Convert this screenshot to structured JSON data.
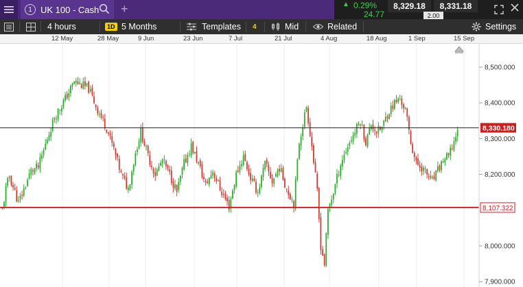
{
  "top_bar": {
    "menu_icon": "hamburger-icon",
    "tab_number": "1",
    "tab_title": "UK 100 - Cash",
    "add_tab_label": "+",
    "change_percent": "0.29%",
    "change_points": "24.77",
    "sell_price": "8,329.18",
    "buy_price": "8,331.18",
    "spread": "2.00",
    "up_color": "#3fcf4f"
  },
  "toolbar": {
    "interval": "4 hours",
    "period_badge": "1D",
    "period": "5 Months",
    "templates": "Templates",
    "indicator_count": "4",
    "price_type": "Mid",
    "related": "Related",
    "settings": "Settings"
  },
  "chart_data": {
    "type": "candlestick",
    "x_ticks": [
      "12 May",
      "28 May",
      "9 Jun",
      "23 Jun",
      "7 Jul",
      "21 Jul",
      "4 Aug",
      "18 Aug",
      "1 Sep",
      "15 Sep"
    ],
    "y_ticks": [
      "8,500.000",
      "8,400.000",
      "8,300.000",
      "8,200.000",
      "8,000.000",
      "7,900.000"
    ],
    "y_tick_values": [
      8500,
      8400,
      8300,
      8200,
      8000,
      7900
    ],
    "ylim": [
      7885,
      8565
    ],
    "current_price": "8,330.180",
    "current_price_value": 8330.18,
    "level_price": "8,107.322",
    "level_price_value": 8107.322,
    "up_color": "#2cad2c",
    "down_color": "#d23b2f",
    "level_color": "#e01b1b",
    "anchors": [
      [
        0,
        8100
      ],
      [
        2,
        8160
      ],
      [
        4,
        8195
      ],
      [
        5,
        8180
      ],
      [
        9,
        8120
      ],
      [
        16,
        8210
      ],
      [
        20,
        8220
      ],
      [
        22,
        8250
      ],
      [
        25,
        8300
      ],
      [
        29,
        8360
      ],
      [
        36,
        8420
      ],
      [
        40,
        8460
      ],
      [
        44,
        8450
      ],
      [
        48,
        8440
      ],
      [
        53,
        8380
      ],
      [
        58,
        8330
      ],
      [
        62,
        8270
      ],
      [
        66,
        8200
      ],
      [
        70,
        8160
      ],
      [
        74,
        8260
      ],
      [
        77,
        8320
      ],
      [
        81,
        8250
      ],
      [
        85,
        8200
      ],
      [
        89,
        8240
      ],
      [
        93,
        8200
      ],
      [
        97,
        8150
      ],
      [
        101,
        8230
      ],
      [
        105,
        8280
      ],
      [
        109,
        8230
      ],
      [
        113,
        8170
      ],
      [
        117,
        8210
      ],
      [
        121,
        8160
      ],
      [
        126,
        8110
      ],
      [
        130,
        8200
      ],
      [
        134,
        8250
      ],
      [
        138,
        8190
      ],
      [
        142,
        8150
      ],
      [
        146,
        8230
      ],
      [
        150,
        8180
      ],
      [
        154,
        8220
      ],
      [
        158,
        8160
      ],
      [
        162,
        8120
      ],
      [
        165,
        8290
      ],
      [
        169,
        8390
      ],
      [
        172,
        8280
      ],
      [
        175,
        8150
      ],
      [
        177,
        8000
      ],
      [
        179,
        7950
      ],
      [
        181,
        8100
      ],
      [
        184,
        8150
      ],
      [
        188,
        8230
      ],
      [
        192,
        8280
      ],
      [
        196,
        8320
      ],
      [
        199,
        8350
      ],
      [
        202,
        8290
      ],
      [
        205,
        8340
      ],
      [
        208,
        8320
      ],
      [
        211,
        8330
      ],
      [
        214,
        8370
      ],
      [
        218,
        8400
      ],
      [
        221,
        8410
      ],
      [
        224,
        8380
      ],
      [
        227,
        8290
      ],
      [
        230,
        8230
      ],
      [
        233,
        8220
      ],
      [
        236,
        8200
      ],
      [
        239,
        8180
      ],
      [
        242,
        8210
      ],
      [
        245,
        8240
      ],
      [
        248,
        8250
      ],
      [
        251,
        8290
      ],
      [
        253,
        8330
      ]
    ]
  }
}
